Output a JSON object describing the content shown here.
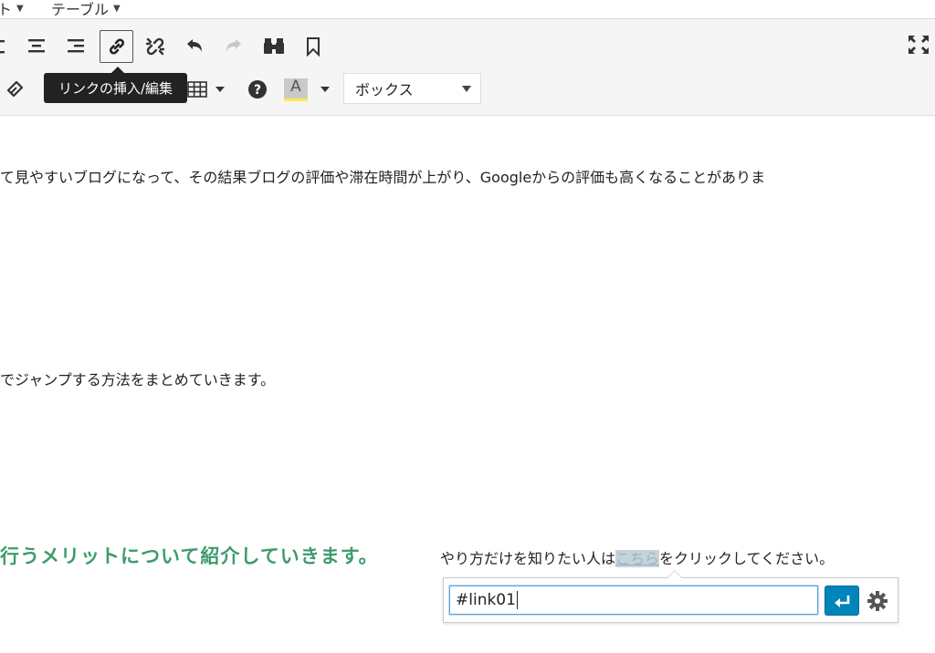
{
  "menubar": {
    "items": [
      {
        "label": "ト"
      },
      {
        "label": "テーブル"
      }
    ]
  },
  "toolbar": {
    "tooltip": "リンクの挿入/編集",
    "format_select": {
      "selected": "ボックス"
    },
    "icons": [
      "align-left-icon",
      "align-center-icon",
      "align-right-icon",
      "link-icon",
      "unlink-icon",
      "undo-icon",
      "redo-icon",
      "find-icon",
      "bookmark-icon",
      "fullscreen-icon",
      "eraser-icon",
      "table-icon",
      "help-icon",
      "text-color-icon"
    ],
    "text_color_label": "A"
  },
  "content": {
    "line1": "て見やすいブログになって、その結果ブログの評価や滞在時間が上がり、Googleからの評価も高くなることがありま",
    "line2": "でジャンプする方法をまとめていきます。",
    "heading": "行うメリットについて紹介していきます。",
    "para_before": "やり方だけを知りたい人は",
    "link_text": "こちら",
    "para_after": "をクリックしてください。"
  },
  "link_popup": {
    "url_value": "#link01"
  },
  "colors": {
    "heading_green": "#3e9c6b",
    "apply_blue": "#0085ba",
    "text_color_underline": "#ffe94d"
  }
}
